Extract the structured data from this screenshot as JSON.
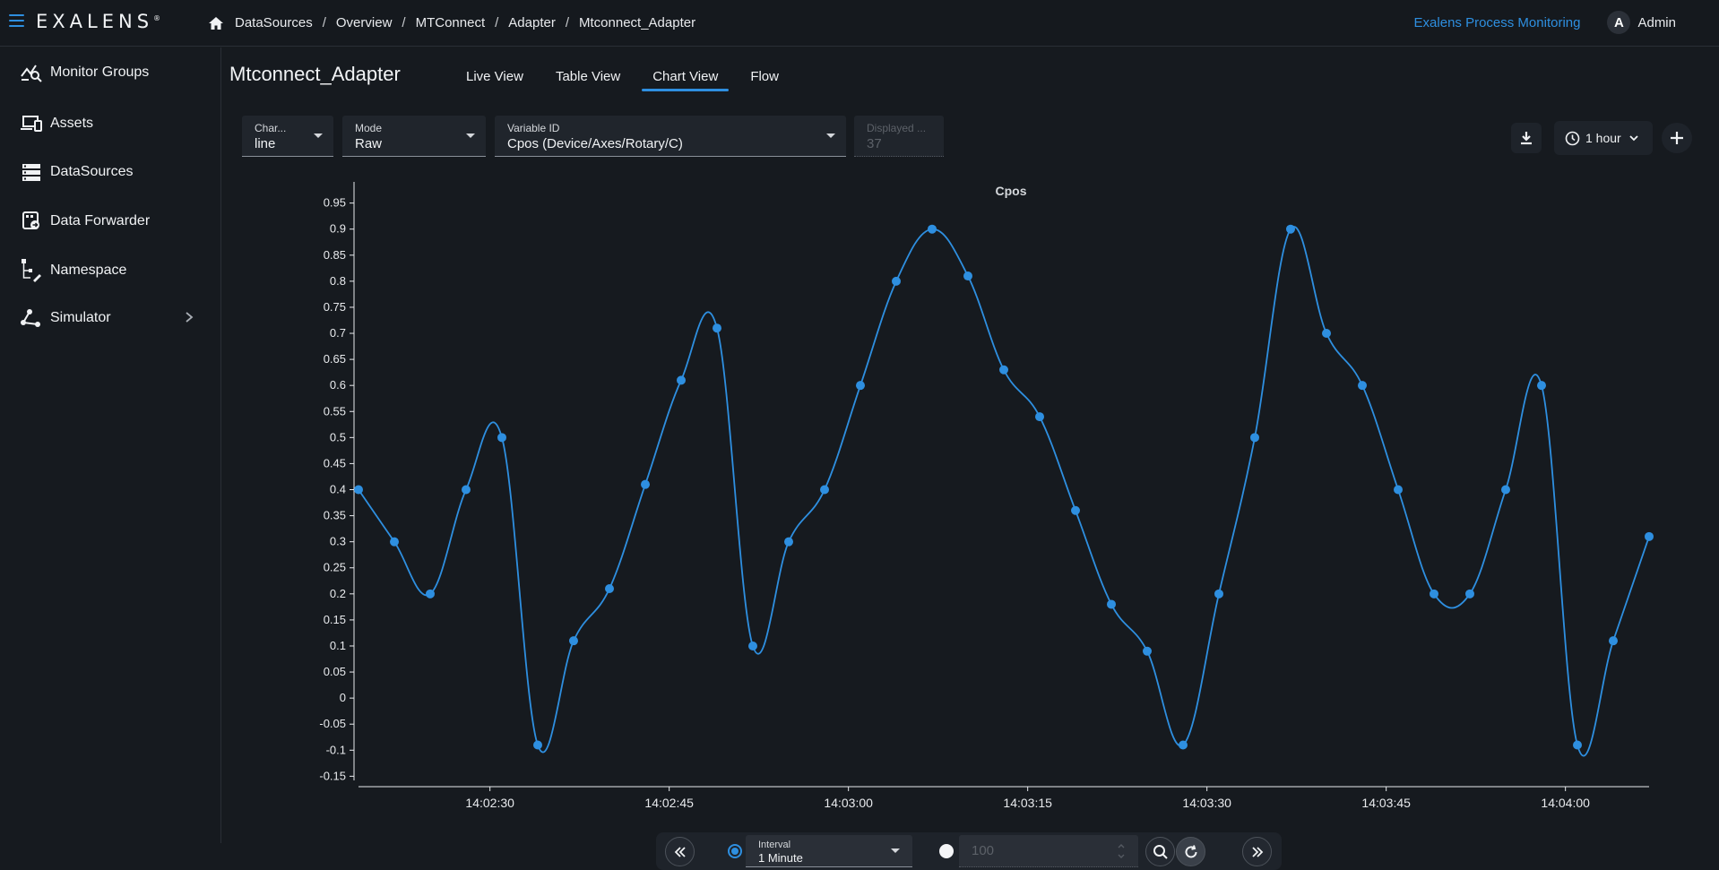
{
  "header": {
    "logo": "EXALENS",
    "breadcrumbs": [
      "DataSources",
      "Overview",
      "MTConnect",
      "Adapter",
      "Mtconnect_Adapter"
    ],
    "app_link": "Exalens Process Monitoring",
    "user_initial": "A",
    "user_name": "Admin"
  },
  "sidebar": {
    "items": [
      {
        "label": "Monitor Groups",
        "icon": "monitor-groups-icon"
      },
      {
        "label": "Assets",
        "icon": "assets-icon"
      },
      {
        "label": "DataSources",
        "icon": "datasources-icon"
      },
      {
        "label": "Data Forwarder",
        "icon": "data-forwarder-icon"
      },
      {
        "label": "Namespace",
        "icon": "namespace-icon"
      },
      {
        "label": "Simulator",
        "icon": "simulator-icon",
        "expandable": true
      }
    ]
  },
  "page": {
    "title": "Mtconnect_Adapter",
    "tabs": [
      "Live View",
      "Table View",
      "Chart View",
      "Flow"
    ],
    "active_tab": "Chart View"
  },
  "controls": {
    "chart_type": {
      "label": "Char...",
      "value": "line"
    },
    "mode": {
      "label": "Mode",
      "value": "Raw"
    },
    "variable": {
      "label": "Variable ID",
      "value": "Cpos (Device/Axes/Rotary/C)"
    },
    "displayed": {
      "label": "Displayed ...",
      "value": "37"
    },
    "time_range": "1 hour"
  },
  "chart_data": {
    "type": "line",
    "title": "Cpos",
    "series_color": "#2e8fe0",
    "ylim": [
      -0.17,
      0.97
    ],
    "y_ticks": [
      0.95,
      0.9,
      0.85,
      0.8,
      0.75,
      0.7,
      0.65,
      0.6,
      0.55,
      0.5,
      0.45,
      0.4,
      0.35,
      0.3,
      0.25,
      0.2,
      0.15,
      0.1,
      0.05,
      0,
      -0.05,
      -0.1,
      -0.15
    ],
    "x_ticks": [
      "14:02:30",
      "14:02:45",
      "14:03:00",
      "14:03:15",
      "14:03:30",
      "14:03:45",
      "14:04:00"
    ],
    "x_range_seconds": [
      0,
      108
    ],
    "x_tick_seconds": [
      11,
      26,
      41,
      56,
      71,
      86,
      101
    ],
    "x": [
      "14:02:19",
      "14:02:22",
      "14:02:25",
      "14:02:28",
      "14:02:31",
      "14:02:34",
      "14:02:37",
      "14:02:40",
      "14:02:43",
      "14:02:46",
      "14:02:49",
      "14:02:52",
      "14:02:55",
      "14:02:58",
      "14:03:01",
      "14:03:04",
      "14:03:07",
      "14:03:10",
      "14:03:13",
      "14:03:16",
      "14:03:19",
      "14:03:22",
      "14:03:25",
      "14:03:28",
      "14:03:31",
      "14:03:34",
      "14:03:37",
      "14:03:40",
      "14:03:43",
      "14:03:46",
      "14:03:49",
      "14:03:52",
      "14:03:55",
      "14:03:58",
      "14:04:01",
      "14:04:04",
      "14:04:07"
    ],
    "values": [
      0.4,
      0.3,
      0.2,
      0.4,
      0.5,
      -0.09,
      0.11,
      0.21,
      0.41,
      0.61,
      0.71,
      0.1,
      0.3,
      0.4,
      0.6,
      0.8,
      0.9,
      0.81,
      0.63,
      0.54,
      0.36,
      0.18,
      0.09,
      -0.09,
      0.2,
      0.5,
      0.9,
      0.7,
      0.6,
      0.4,
      0.2,
      0.2,
      0.4,
      0.6,
      -0.09,
      0.11,
      0.31
    ]
  },
  "bottom": {
    "interval_label": "Interval",
    "interval_value": "1 Minute",
    "count_placeholder": "100"
  }
}
